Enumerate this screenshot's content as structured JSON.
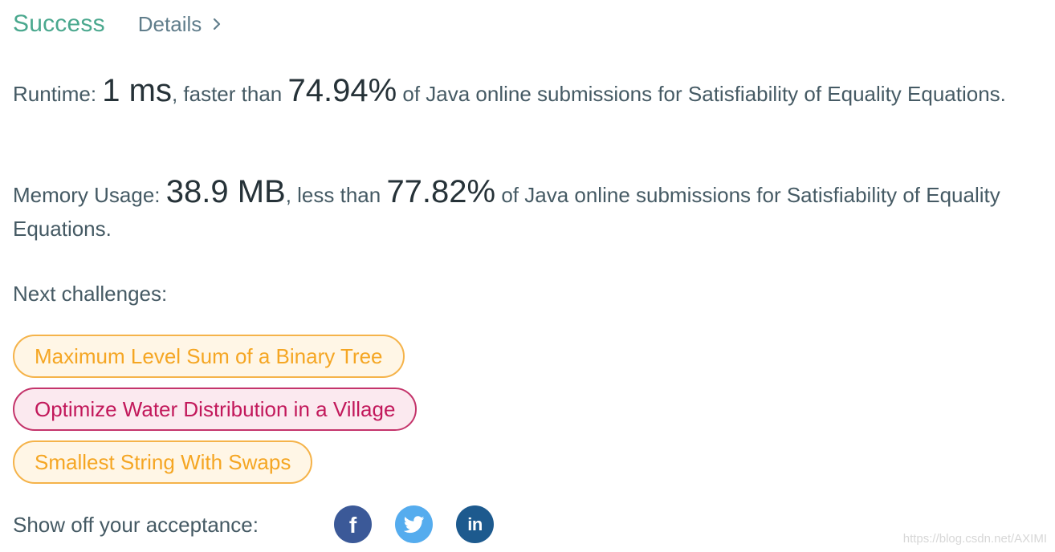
{
  "header": {
    "status": "Success",
    "details_label": "Details"
  },
  "runtime": {
    "label": "Runtime: ",
    "value": "1 ms",
    "comparison": ", faster than ",
    "percent": "74.94%",
    "suffix": " of Java online submissions for Satisfiability of Equality Equations."
  },
  "memory": {
    "label": "Memory Usage: ",
    "value": "38.9 MB",
    "comparison": ", less than ",
    "percent": "77.82%",
    "suffix": " of Java online submissions for Satisfiability of Equality Equations."
  },
  "next_challenges": {
    "label": "Next challenges:",
    "items": [
      {
        "title": "Maximum Level Sum of a Binary Tree",
        "difficulty_color": "#f5a623"
      },
      {
        "title": "Optimize Water Distribution in a Village",
        "difficulty_color": "#c2185b"
      },
      {
        "title": "Smallest String With Swaps",
        "difficulty_color": "#f5a623"
      }
    ]
  },
  "share": {
    "label": "Show off your acceptance:",
    "networks": [
      {
        "icon": "facebook-icon",
        "glyph": "f",
        "color": "#3b5998"
      },
      {
        "icon": "twitter-icon",
        "color": "#55acee"
      },
      {
        "icon": "linkedin-icon",
        "glyph": "in",
        "color": "#1d5a8e"
      }
    ]
  },
  "watermark": "https://blog.csdn.net/AXIMI",
  "colors": {
    "success": "#4aa88e",
    "text": "#455a64",
    "medium": "#f5a623",
    "hard": "#c2185b"
  }
}
